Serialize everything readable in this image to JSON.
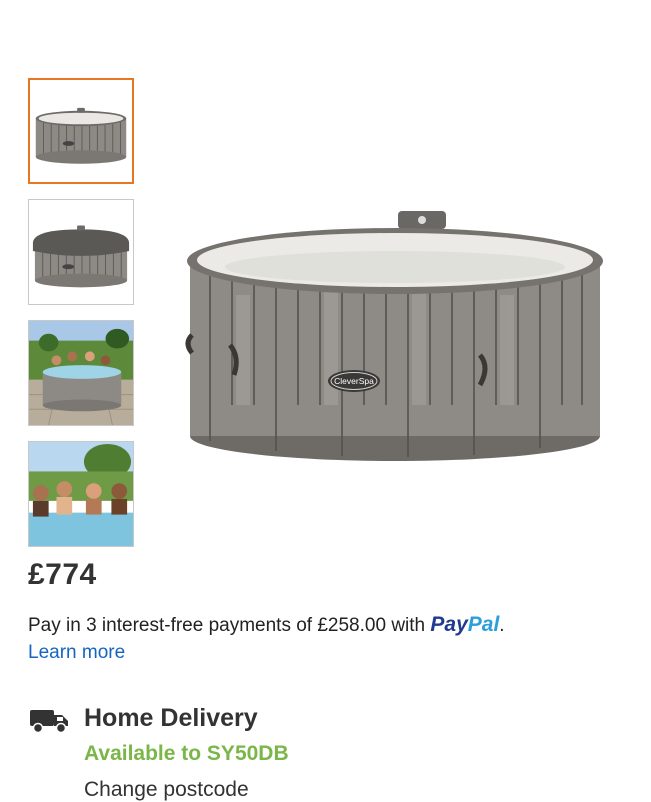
{
  "gallery": {
    "thumbnails": [
      {
        "name": "hot-tub-lid-off",
        "selected": true
      },
      {
        "name": "hot-tub-lid-on",
        "selected": false
      },
      {
        "name": "hot-tub-garden-scene",
        "selected": false
      },
      {
        "name": "hot-tub-people-closeup",
        "selected": false
      }
    ],
    "main_image_badge": "CleverSpa",
    "accent_color": "#e87722"
  },
  "product": {
    "price": "£774"
  },
  "paypal": {
    "text": "Pay in 3 interest-free payments of £258.00 with",
    "brand_pay": "Pay",
    "brand_pal": "Pal",
    "suffix": ".",
    "learn_more": "Learn more"
  },
  "delivery": {
    "icon": "truck-icon",
    "title": "Home Delivery",
    "availability": "Available to SY50DB",
    "availability_color": "#7ab648",
    "change_postcode": "Change postcode"
  }
}
